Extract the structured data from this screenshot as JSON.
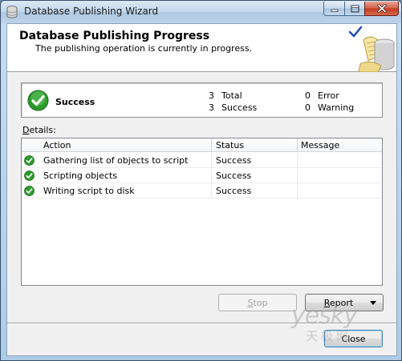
{
  "window": {
    "title": "Database Publishing Wizard"
  },
  "header": {
    "title": "Database Publishing Progress",
    "subtitle": "The publishing operation is currently in progress."
  },
  "summary": {
    "status": "Success",
    "total_count": "3",
    "total_label": "Total",
    "success_count": "3",
    "success_label": "Success",
    "error_count": "0",
    "error_label": "Error",
    "warning_count": "0",
    "warning_label": "Warning"
  },
  "details": {
    "label_first": "D",
    "label_rest": "etails:",
    "columns": [
      "Action",
      "Status",
      "Message"
    ],
    "rows": [
      {
        "icon": "success-check-icon",
        "action": "Gathering list of objects to script",
        "status": "Success",
        "message": ""
      },
      {
        "icon": "success-check-icon",
        "action": "Scripting objects",
        "status": "Success",
        "message": ""
      },
      {
        "icon": "success-check-icon",
        "action": "Writing script to disk",
        "status": "Success",
        "message": ""
      }
    ]
  },
  "buttons": {
    "stop_first": "S",
    "stop_rest": "top",
    "report_first": "R",
    "report_rest": "eport",
    "close_label": "Close"
  },
  "watermark": {
    "text": "yesky",
    "text_cn": "天极网"
  },
  "colors": {
    "success_green": "#2e9a2e",
    "close_red": "#c23a1e",
    "default_button_border": "#3c7fb1"
  }
}
